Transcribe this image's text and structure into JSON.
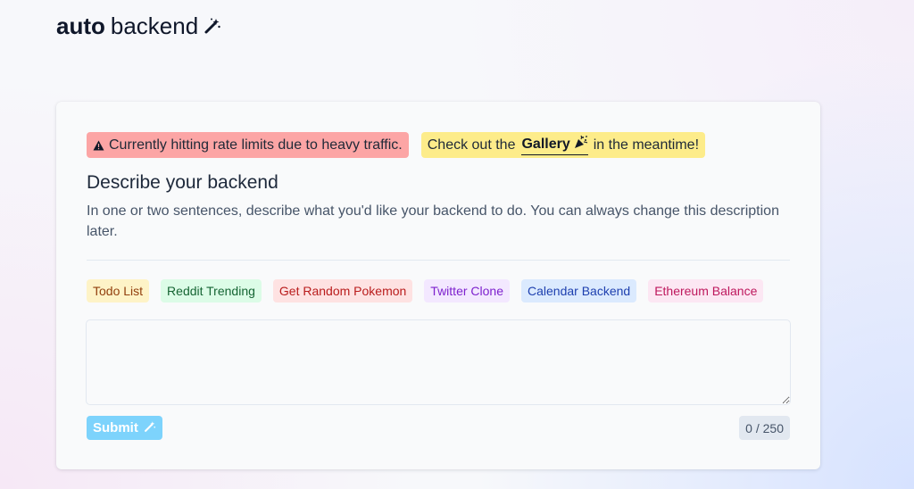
{
  "logo": {
    "bold": "auto",
    "regular": "backend",
    "icon": "magic-wand-icon"
  },
  "alerts": {
    "rate_limit": {
      "icon": "warning-triangle-icon",
      "text": "Currently hitting rate limits due to heavy traffic."
    },
    "gallery": {
      "prefix": "Check out the",
      "link_label": "Gallery",
      "link_icon": "party-popper-icon",
      "suffix": "in the meantime!"
    }
  },
  "form": {
    "heading": "Describe your backend",
    "description": "In one or two sentences, describe what you'd like your backend to do. You can always change this description later.",
    "examples": [
      {
        "label": "Todo List",
        "bg": "#fef3c7",
        "fg": "#92400e"
      },
      {
        "label": "Reddit Trending",
        "bg": "#dcfce7",
        "fg": "#166534"
      },
      {
        "label": "Get Random Pokemon",
        "bg": "#fee2e2",
        "fg": "#b91c1c"
      },
      {
        "label": "Twitter Clone",
        "bg": "#f3e8ff",
        "fg": "#7e22ce"
      },
      {
        "label": "Calendar Backend",
        "bg": "#dbeafe",
        "fg": "#1e40af"
      },
      {
        "label": "Ethereum Balance",
        "bg": "#fce7f3",
        "fg": "#be185d"
      }
    ],
    "input_value": "",
    "submit_label": "Submit",
    "submit_icon": "magic-wand-icon",
    "counter": "0 / 250"
  },
  "colors": {
    "alert_red": "#fca5a5",
    "alert_yellow": "#fdec8a",
    "submit_bg": "#7dd3fc",
    "counter_bg": "#e2e8f0"
  }
}
